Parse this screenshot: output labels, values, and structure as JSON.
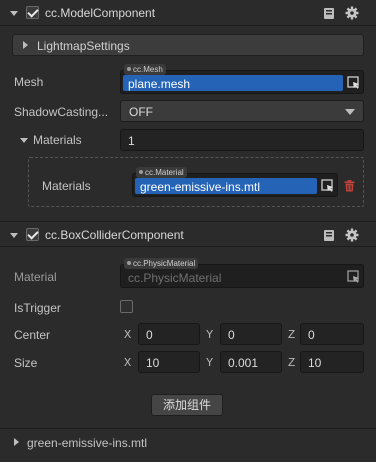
{
  "model_component": {
    "title": "cc.ModelComponent",
    "enabled": true,
    "lightmap_label": "LightmapSettings",
    "mesh_label": "Mesh",
    "mesh_type": "cc.Mesh",
    "mesh_value": "plane.mesh",
    "shadow_label": "ShadowCasting...",
    "shadow_value": "OFF",
    "materials_label": "Materials",
    "materials_count": "1",
    "materials_item_label": "Materials",
    "material_type": "cc.Material",
    "material_value": "green-emissive-ins.mtl"
  },
  "box_collider": {
    "title": "cc.BoxColliderComponent",
    "enabled": true,
    "material_label": "Material",
    "material_type": "cc.PhysicMaterial",
    "material_placeholder": "cc.PhysicMaterial",
    "istrigger_label": "IsTrigger",
    "istrigger": false,
    "center_label": "Center",
    "center": {
      "x": "0",
      "y": "0",
      "z": "0"
    },
    "size_label": "Size",
    "size": {
      "x": "10",
      "y": "0.001",
      "z": "10"
    },
    "axis": {
      "x": "X",
      "y": "Y",
      "z": "Z"
    }
  },
  "add_component_label": "添加组件",
  "footer_asset": "green-emissive-ins.mtl",
  "icons": [
    "book-icon",
    "gear-icon",
    "browse-icon",
    "trash-icon"
  ],
  "colors": {
    "accent": "#2463b5",
    "background": "#2b2b2b",
    "trash": "#c0403a"
  }
}
